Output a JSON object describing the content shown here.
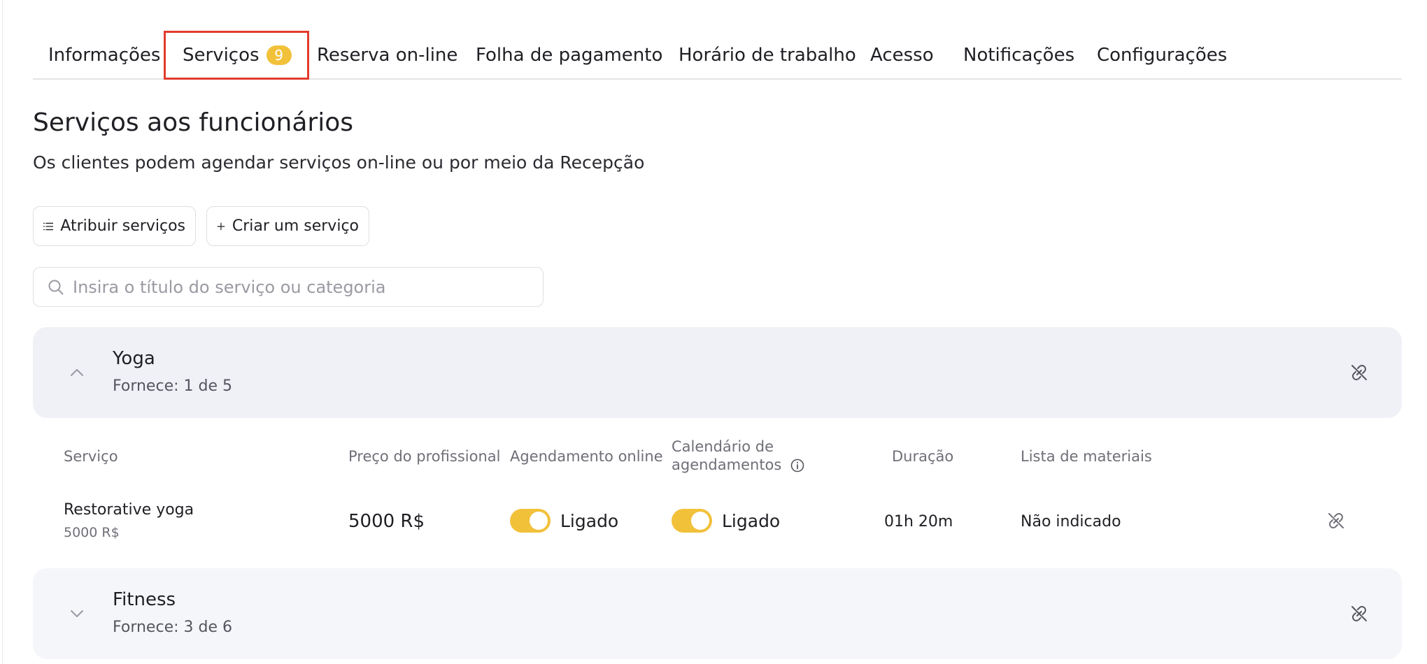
{
  "tabs": [
    {
      "label": "Informações"
    },
    {
      "label": "Serviços",
      "badge": "9"
    },
    {
      "label": "Reserva on-line"
    },
    {
      "label": "Folha de pagamento"
    },
    {
      "label": "Horário de trabalho"
    },
    {
      "label": "Acesso"
    },
    {
      "label": "Notificações"
    },
    {
      "label": "Configurações"
    }
  ],
  "header": {
    "title": "Serviços aos funcionários",
    "subtitle": "Os clientes podem agendar serviços on-line ou por meio da Recepção"
  },
  "actions": {
    "assign_label": "Atribuir serviços",
    "create_label": "Criar um serviço"
  },
  "search": {
    "placeholder": "Insira o título do serviço ou categoria",
    "value": ""
  },
  "categories": [
    {
      "name": "Yoga",
      "meta": "Fornece: 1 de 5",
      "expanded": true
    },
    {
      "name": "Fitness",
      "meta": "Fornece: 3 de 6",
      "expanded": false
    }
  ],
  "table": {
    "headers": {
      "service": "Serviço",
      "price": "Preço do profissional",
      "online": "Agendamento online",
      "calendar_line1": "Calendário de",
      "calendar_line2": "agendamentos",
      "duration": "Duração",
      "materials": "Lista de materiais"
    },
    "rows": [
      {
        "name": "Restorative yoga",
        "sub_price": "5000 R$",
        "price": "5000 R$",
        "online": "Ligado",
        "calendar": "Ligado",
        "duration": "01h 20m",
        "materials": "Não indicado"
      }
    ]
  },
  "colors": {
    "accent": "#f2c13a",
    "highlight_border": "#e23b2c",
    "panel_bg": "#f0f1f6"
  }
}
